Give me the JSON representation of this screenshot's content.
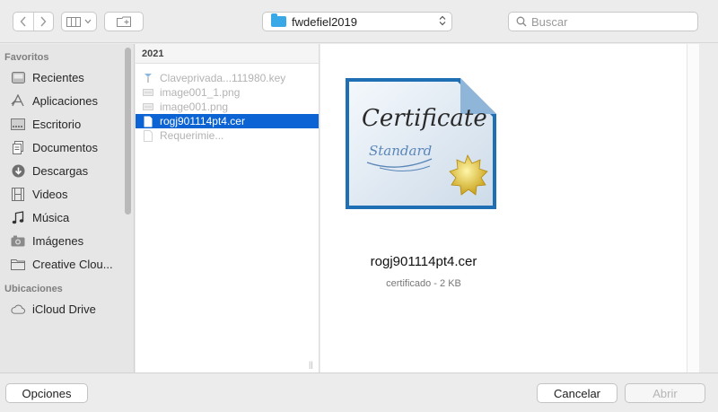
{
  "toolbar": {
    "path_popup_label": "fwdefiel2019",
    "search_placeholder": "Buscar"
  },
  "sidebar": {
    "favorites_header": "Favoritos",
    "favorites": [
      {
        "label": "Recientes",
        "icon": "recents-icon"
      },
      {
        "label": "Aplicaciones",
        "icon": "applications-icon"
      },
      {
        "label": "Escritorio",
        "icon": "desktop-icon"
      },
      {
        "label": "Documentos",
        "icon": "documents-icon"
      },
      {
        "label": "Descargas",
        "icon": "downloads-icon"
      },
      {
        "label": "Videos",
        "icon": "videos-icon"
      },
      {
        "label": "Música",
        "icon": "music-icon"
      },
      {
        "label": "Imágenes",
        "icon": "pictures-icon"
      },
      {
        "label": "Creative Clou...",
        "icon": "folder-icon"
      }
    ],
    "locations_header": "Ubicaciones",
    "locations": [
      {
        "label": "iCloud Drive",
        "icon": "cloud-icon"
      }
    ]
  },
  "column": {
    "header": "2021",
    "files": [
      {
        "name": "Claveprivada...111980.key",
        "icon": "key-file-icon",
        "selected": false
      },
      {
        "name": "image001_1.png",
        "icon": "image-file-icon",
        "selected": false
      },
      {
        "name": "image001.png",
        "icon": "image-file-icon",
        "selected": false
      },
      {
        "name": "rogj901114pt4.cer",
        "icon": "document-icon",
        "selected": true
      },
      {
        "name": "Requerimie...",
        "icon": "document-icon",
        "selected": false
      }
    ]
  },
  "preview": {
    "cert_script_title": "Certificate",
    "cert_script_subtitle": "Standard",
    "file_name": "rogj901114pt4.cer",
    "file_meta": "certificado - 2 KB"
  },
  "buttons": {
    "options": "Opciones",
    "cancel": "Cancelar",
    "open": "Abrir"
  }
}
